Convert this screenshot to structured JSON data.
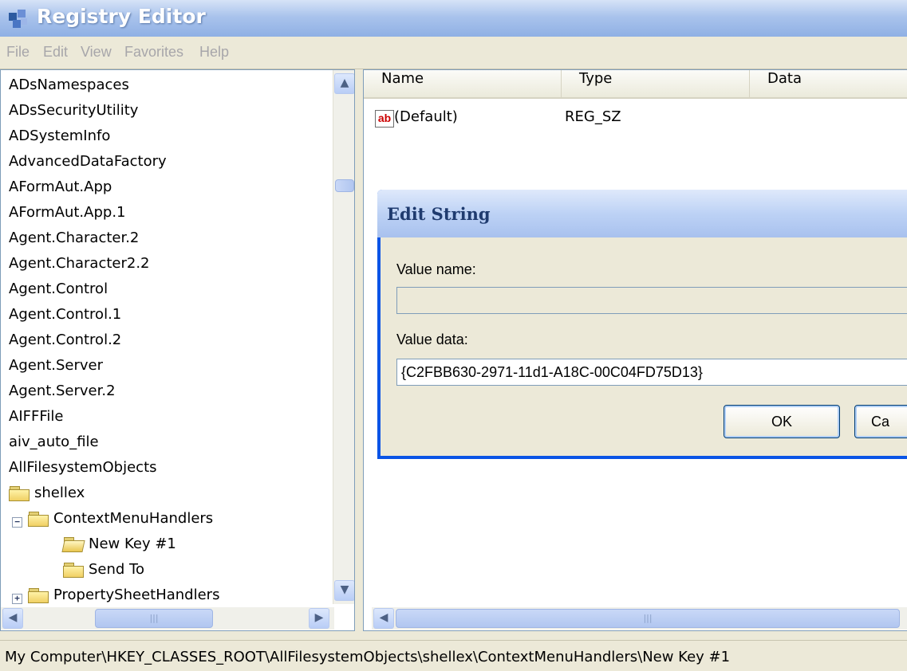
{
  "window": {
    "title": "Registry Editor"
  },
  "menu": {
    "items": [
      "File",
      "Edit",
      "View",
      "Favorites",
      "Help"
    ]
  },
  "tree": {
    "items": [
      "ADsNamespaces",
      "ADsSecurityUtility",
      "ADSystemInfo",
      "AdvancedDataFactory",
      "AFormAut.App",
      "AFormAut.App.1",
      "Agent.Character.2",
      "Agent.Character2.2",
      "Agent.Control",
      "Agent.Control.1",
      "Agent.Control.2",
      "Agent.Server",
      "Agent.Server.2",
      "AIFFFile",
      "aiv_auto_file",
      "AllFilesystemObjects"
    ],
    "folders": {
      "shellex": "shellex",
      "context_menu_handlers": "ContextMenuHandlers",
      "new_key": "New Key #1",
      "send_to": "Send To",
      "property_sheet_handlers": "PropertySheetHandlers"
    }
  },
  "list": {
    "columns": [
      "Name",
      "Type",
      "Data"
    ],
    "rows": [
      {
        "icon": "ab",
        "name": "(Default)",
        "type": "REG_SZ",
        "data": ""
      }
    ]
  },
  "dialog": {
    "title": "Edit String",
    "value_name_label": "Value name:",
    "value_name": "",
    "value_data_label": "Value data:",
    "value_data": "{C2FBB630-2971-11d1-A18C-00C04FD75D13}",
    "ok_label": "OK",
    "cancel_label": "Ca"
  },
  "status": {
    "path": "My Computer\\HKEY_CLASSES_ROOT\\AllFilesystemObjects\\shellex\\ContextMenuHandlers\\New Key #1"
  },
  "icons": {
    "app": "registry-editor-icon",
    "string_value": "string-value-icon",
    "folder": "folder-icon"
  },
  "colors": {
    "dialog_border": "#0a54e6",
    "title_gradient_end": "#8fb0e4"
  }
}
